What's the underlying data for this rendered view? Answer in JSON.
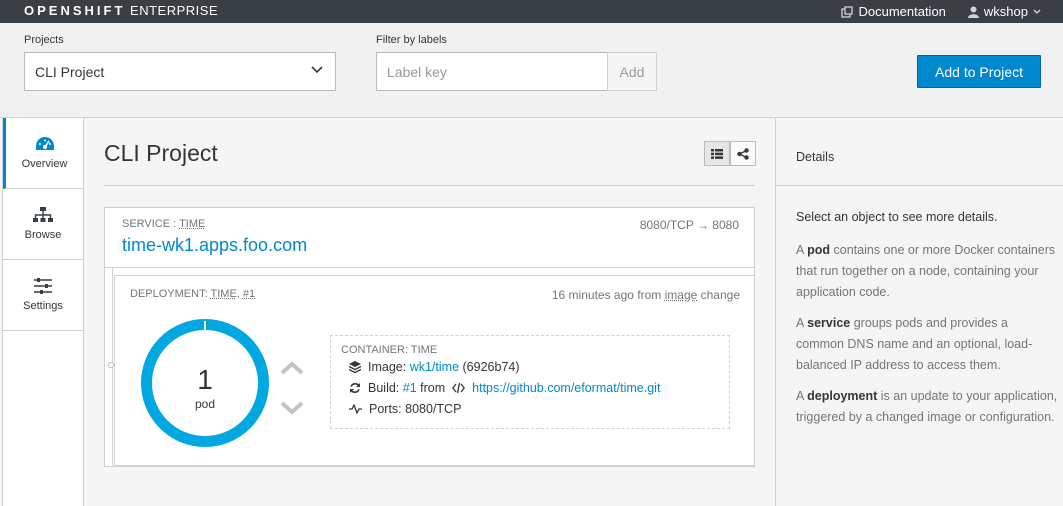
{
  "brand": {
    "bold": "OPENSHIFT",
    "thin": "ENTERPRISE"
  },
  "topnav": {
    "documentation": "Documentation",
    "user": "wkshop"
  },
  "toolbar": {
    "projects_label": "Projects",
    "project_value": "CLI Project",
    "filter_label": "Filter by labels",
    "label_placeholder": "Label key",
    "add_label": "Add",
    "add_to_project": "Add to Project"
  },
  "leftnav": {
    "items": [
      {
        "label": "Overview",
        "icon": "dashboard-icon",
        "active": true
      },
      {
        "label": "Browse",
        "icon": "sitemap-icon"
      },
      {
        "label": "Settings",
        "icon": "sliders-icon"
      }
    ]
  },
  "main": {
    "title": "CLI Project",
    "service": {
      "type_prefix": "SERVICE : ",
      "type_name": "TIME",
      "hostname": "time-wk1.apps.foo.com",
      "port": "8080/TCP → 8080"
    },
    "deployment": {
      "type_prefix": "DEPLOYMENT: ",
      "name": "TIME",
      "sep": ", ",
      "revision": "#1",
      "time_prefix": "16 minutes ago from ",
      "time_trigger": "image",
      "time_suffix": " change",
      "pod_count": "1",
      "pod_label": "pod",
      "ring_color": "#00a8e1"
    },
    "container": {
      "title": "CONTAINER: TIME",
      "image_label": "Image:",
      "image_link": "wk1/time",
      "image_id": "(6926b74)",
      "build_label": "Build:",
      "build_link": "#1",
      "build_from": "from",
      "build_repo": "https://github.com/eformat/time.git",
      "ports_label": "Ports:",
      "ports_value": "8080/TCP"
    }
  },
  "details": {
    "title": "Details",
    "lead": "Select an object to see more details.",
    "paragraphs": [
      {
        "a": "A ",
        "b": "pod",
        "c": " contains one or more Docker containers that run together on a node, containing your application code."
      },
      {
        "a": "A ",
        "b": "service",
        "c": " groups pods and provides a common DNS name and an optional, load-balanced IP address to access them."
      },
      {
        "a": "A ",
        "b": "deployment",
        "c": " is an update to your application, triggered by a changed image or configuration."
      }
    ]
  },
  "colors": {
    "accent": "#0088ce",
    "topbar": "#393f45"
  }
}
